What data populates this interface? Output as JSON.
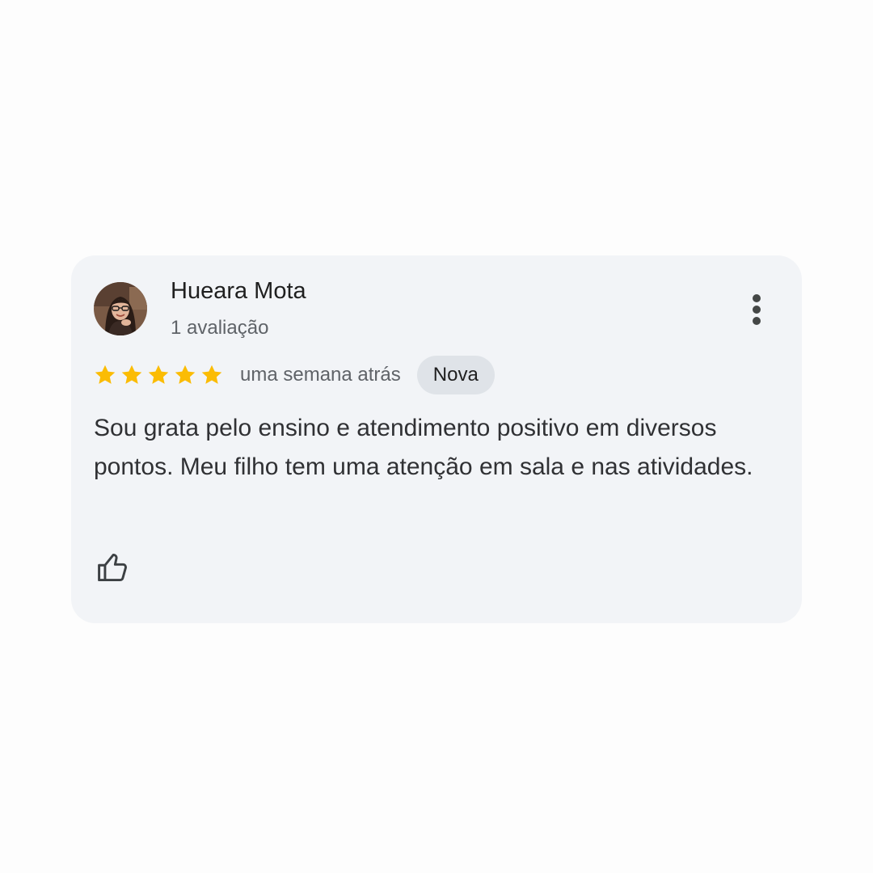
{
  "review": {
    "author_name": "Hueara Mota",
    "review_count": "1 avaliação",
    "rating": 5,
    "rating_max": 5,
    "time_ago": "uma semana atrás",
    "badge": "Nova",
    "text": "Sou grata pelo ensino e atendimento positivo em diversos pontos. Meu filho tem uma atenção em sala e nas atividades.",
    "icons": {
      "avatar": "profile-photo",
      "menu": "more-vertical-icon",
      "like": "thumbs-up-icon",
      "star": "star-icon"
    }
  },
  "colors": {
    "card_background": "#f2f4f7",
    "star": "#fbbc04",
    "badge_background": "#dfe3e8",
    "text_primary": "#1f1f1f",
    "text_secondary": "#5f6368"
  }
}
